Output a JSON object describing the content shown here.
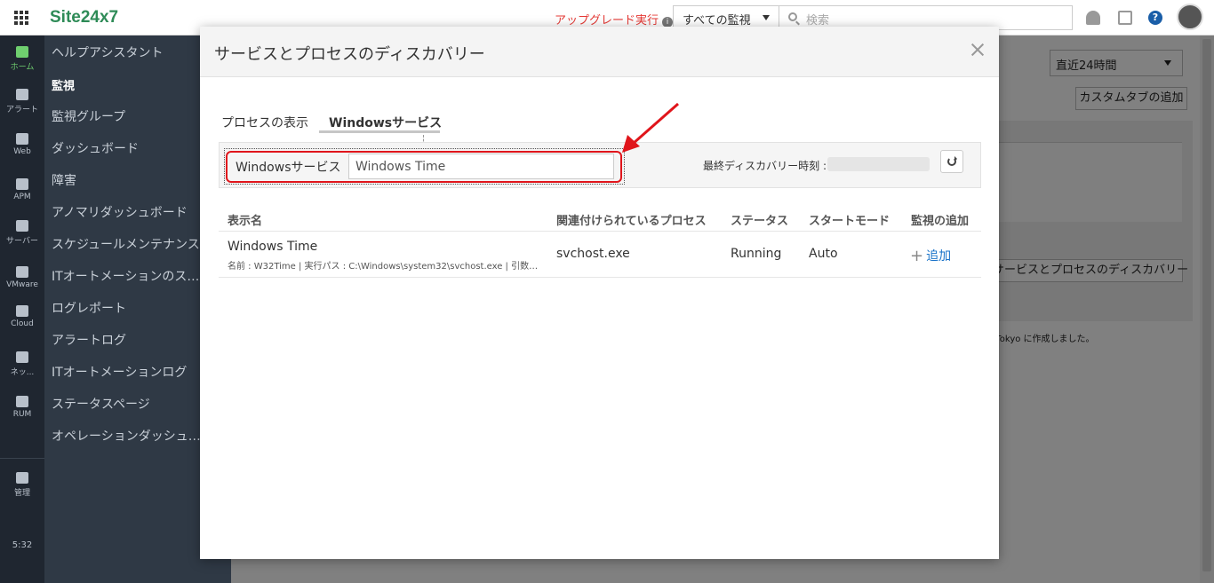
{
  "app": {
    "logo": "Site24x7",
    "upgrade_label": "アップグレード実行",
    "monitor_select": "すべての監視",
    "search_placeholder": "検索"
  },
  "rail": {
    "items": [
      {
        "label": "ホーム",
        "icon": "home-icon"
      },
      {
        "label": "アラート",
        "icon": "bell-icon"
      },
      {
        "label": "Web",
        "icon": "globe-icon"
      },
      {
        "label": "APM",
        "icon": "binoculars-icon"
      },
      {
        "label": "サーバー",
        "icon": "server-icon"
      },
      {
        "label": "VMware",
        "icon": "vmware-icon"
      },
      {
        "label": "Cloud",
        "icon": "cloud-icon"
      },
      {
        "label": "ネッ...",
        "icon": "network-icon"
      },
      {
        "label": "RUM",
        "icon": "rum-icon"
      },
      {
        "label": "管理",
        "icon": "gear-icon"
      }
    ],
    "time": "5:32"
  },
  "sidebar": {
    "items": [
      "ヘルプアシスタント",
      "監視",
      "監視グループ",
      "ダッシュボード",
      "障害",
      "アノマリダッシュボード",
      "スケジュールメンテナンス",
      "ITオートメーションのスケ...",
      "ログレポート",
      "アラートログ",
      "ITオートメーションログ",
      "ステータスページ",
      "オペレーションダッシュボ..."
    ]
  },
  "background": {
    "time_range": "直近24時間",
    "add_custom_tab": "カスタムタブの追加",
    "discovery_button": "サービスとプロセスのディスカバリー",
    "note": "/Tokyo に作成しました。"
  },
  "modal": {
    "title": "サービスとプロセスのディスカバリー",
    "tabs": [
      "プロセスの表示",
      "Windowsサービス"
    ],
    "filter_label": "Windowsサービス",
    "filter_value": "Windows Time",
    "last_discovery_label": "最終ディスカバリー時刻 :",
    "columns": [
      "表示名",
      "関連付けられているプロセス",
      "ステータス",
      "スタートモード",
      "監視の追加"
    ],
    "rows": [
      {
        "display_name": "Windows Time",
        "details": "名前 : W32Time | 実行パス : C:\\Windows\\system32\\svchost.exe | 引数 : ...",
        "process": "svchost.exe",
        "status": "Running",
        "start_mode": "Auto",
        "add_label": "追加"
      }
    ]
  },
  "colors": {
    "accent": "#1a73c9",
    "highlight": "#e0151b",
    "logo_green": "#2e8b57"
  }
}
